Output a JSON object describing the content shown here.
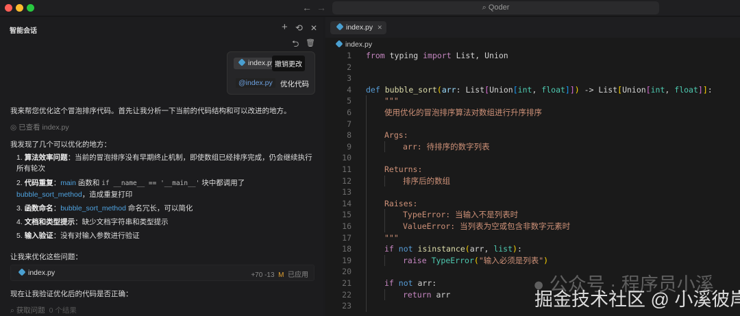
{
  "window": {
    "search_label": "Qoder"
  },
  "chat": {
    "title": "智能会话",
    "popup": {
      "file_chip": "index.py",
      "tooltip": "撤销更改",
      "mention": "@index.py",
      "prompt": "优化代码"
    },
    "intro": "我来帮您优化这个冒泡排序代码。首先让我分析一下当前的代码结构和可以改进的地方。",
    "viewed_label": "已查看",
    "viewed_file": "index.py",
    "found": "我发现了几个可以优化的地方：",
    "items": [
      {
        "num": "1.",
        "title": "算法效率问题",
        "text": "：当前的冒泡排序没有早期终止机制，即使数组已经排序完成，仍会继续执行所有轮次"
      },
      {
        "num": "2.",
        "title": "代码重复",
        "pre": "：",
        "link1": "main",
        "mid": " 函数和 ",
        "code": "if __name__ == '__main__'",
        "mid2": " 块中都调用了 ",
        "link2": "bubble_sort_method",
        "text": "，造成重复打印"
      },
      {
        "num": "3.",
        "title": "函数命名",
        "pre": "：",
        "link1": "bubble_sort_method",
        "text": " 命名冗长，可以简化"
      },
      {
        "num": "4.",
        "title": "文档和类型提示",
        "text": "：缺少文档字符串和类型提示"
      },
      {
        "num": "5.",
        "title": "输入验证",
        "text": "：没有对输入参数进行验证"
      }
    ],
    "optimize": "让我来优化这些问题：",
    "file_card": {
      "name": "index.py",
      "added": "+70",
      "removed": "-13",
      "status": "M",
      "applied": "已应用"
    },
    "verify": "现在让我验证优化后的代码是否正确：",
    "tool": {
      "label": "获取问题",
      "result": "0 个结果"
    }
  },
  "editor": {
    "tab": "index.py",
    "breadcrumb": "index.py",
    "lines": [
      {
        "n": "1",
        "i": 0,
        "t": [
          [
            "from",
            "kw"
          ],
          [
            " typing ",
            "pl"
          ],
          [
            "import",
            "kw"
          ],
          [
            " List, Union",
            "pl"
          ]
        ]
      },
      {
        "n": "2",
        "i": 0,
        "t": []
      },
      {
        "n": "3",
        "i": 0,
        "t": []
      },
      {
        "n": "4",
        "i": 0,
        "t": [
          [
            "def",
            "kb"
          ],
          [
            " ",
            "pl"
          ],
          [
            "bubble_sort",
            "fn"
          ],
          [
            "(",
            "b1"
          ],
          [
            "arr",
            "pm"
          ],
          [
            ": List",
            "pl"
          ],
          [
            "[",
            "b2"
          ],
          [
            "Union",
            "pl"
          ],
          [
            "[",
            "b3"
          ],
          [
            "int",
            "ty"
          ],
          [
            ", ",
            "pl"
          ],
          [
            "float",
            "ty"
          ],
          [
            "]",
            "b3"
          ],
          [
            "]",
            "b2"
          ],
          [
            ")",
            "b1"
          ],
          [
            " -> List",
            "pl"
          ],
          [
            "[",
            "b1"
          ],
          [
            "Union",
            "pl"
          ],
          [
            "[",
            "b2"
          ],
          [
            "int",
            "ty"
          ],
          [
            ", ",
            "pl"
          ],
          [
            "float",
            "ty"
          ],
          [
            "]",
            "b2"
          ],
          [
            "]",
            "b1"
          ],
          [
            ":",
            "pl"
          ]
        ]
      },
      {
        "n": "5",
        "i": 1,
        "t": [
          [
            "\"\"\"",
            "st"
          ]
        ]
      },
      {
        "n": "6",
        "i": 1,
        "t": [
          [
            "使用优化的冒泡排序算法对数组进行升序排序",
            "st"
          ]
        ]
      },
      {
        "n": "7",
        "i": 1,
        "t": []
      },
      {
        "n": "8",
        "i": 1,
        "t": [
          [
            "Args:",
            "st"
          ]
        ]
      },
      {
        "n": "9",
        "i": 2,
        "t": [
          [
            "arr: 待排序的数字列表",
            "st"
          ]
        ]
      },
      {
        "n": "10",
        "i": 1,
        "t": []
      },
      {
        "n": "11",
        "i": 1,
        "t": [
          [
            "Returns:",
            "st"
          ]
        ]
      },
      {
        "n": "12",
        "i": 2,
        "t": [
          [
            "排序后的数组",
            "st"
          ]
        ]
      },
      {
        "n": "13",
        "i": 1,
        "t": []
      },
      {
        "n": "14",
        "i": 1,
        "t": [
          [
            "Raises:",
            "st"
          ]
        ]
      },
      {
        "n": "15",
        "i": 2,
        "t": [
          [
            "TypeError: 当输入不是列表时",
            "st"
          ]
        ]
      },
      {
        "n": "16",
        "i": 2,
        "t": [
          [
            "ValueError: 当列表为空或包含非数字元素时",
            "st"
          ]
        ]
      },
      {
        "n": "17",
        "i": 1,
        "t": [
          [
            "\"\"\"",
            "st"
          ]
        ]
      },
      {
        "n": "18",
        "i": 1,
        "t": [
          [
            "if",
            "kw"
          ],
          [
            " ",
            "pl"
          ],
          [
            "not",
            "kb"
          ],
          [
            " ",
            "pl"
          ],
          [
            "isinstance",
            "fn"
          ],
          [
            "(",
            "b1"
          ],
          [
            "arr, ",
            "pl"
          ],
          [
            "list",
            "ty"
          ],
          [
            ")",
            "b1"
          ],
          [
            ":",
            "pl"
          ]
        ]
      },
      {
        "n": "19",
        "i": 2,
        "t": [
          [
            "raise",
            "kw"
          ],
          [
            " ",
            "pl"
          ],
          [
            "TypeError",
            "ty"
          ],
          [
            "(",
            "b1"
          ],
          [
            "\"输入必须是列表\"",
            "st"
          ],
          [
            ")",
            "b1"
          ]
        ]
      },
      {
        "n": "20",
        "i": 1,
        "t": []
      },
      {
        "n": "21",
        "i": 1,
        "t": [
          [
            "if",
            "kw"
          ],
          [
            " ",
            "pl"
          ],
          [
            "not",
            "kb"
          ],
          [
            " arr:",
            "pl"
          ]
        ]
      },
      {
        "n": "22",
        "i": 2,
        "t": [
          [
            "return",
            "kw"
          ],
          [
            " arr",
            "pl"
          ]
        ]
      },
      {
        "n": "23",
        "i": 1,
        "t": []
      }
    ]
  },
  "watermark": {
    "line1": "公众号 · 程序员小溪",
    "line2": "掘金技术社区 @ 小溪彼岸"
  },
  "colors": {
    "accent": "#4fa3e0",
    "modified": "#e0a030"
  }
}
